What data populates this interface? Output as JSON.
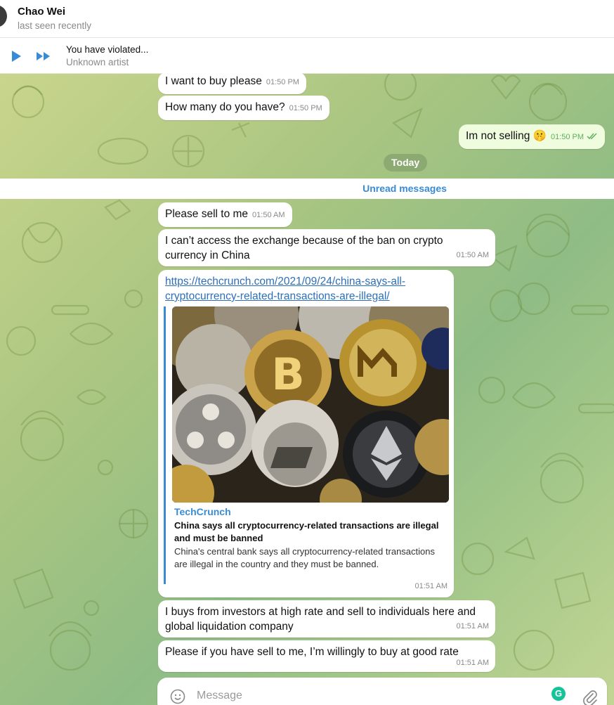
{
  "header": {
    "name": "Chao Wei",
    "status": "last seen recently"
  },
  "player": {
    "title": "You have violated...",
    "artist": "Unknown artist",
    "play_icon": "play-icon",
    "next_icon": "fast-forward-icon"
  },
  "messages_before": [
    {
      "text": "I want to buy please",
      "time": "01:50 PM",
      "direction": "in"
    },
    {
      "text": "How many do you have?",
      "time": "01:50 PM",
      "direction": "in"
    },
    {
      "text": "Im not selling",
      "emoji": "🤫",
      "time": "01:50 PM",
      "direction": "out",
      "read": true
    }
  ],
  "date_divider": "Today",
  "unread_label": "Unread messages",
  "messages_after": [
    {
      "text": "Please sell to me",
      "time": "01:50 AM"
    },
    {
      "text": "I can’t access the exchange because of the ban on crypto currency in China",
      "time": "01:50 AM"
    },
    {
      "link_line1": "https://techcrunch.com/2021/09/24/china-says-all-",
      "link_line2": "cryptocurrency-related-transactions-are-illegal/",
      "preview": {
        "site": "TechCrunch",
        "title": "China says all cryptocurrency-related transactions are illegal and must be banned",
        "description": "China's central bank says all cryptocurrency-related transactions are illegal in the country and they must be banned.",
        "image_alt": "crypto-coins-image"
      },
      "time": "01:51 AM"
    },
    {
      "text": "I buys from investors at high rate and sell to individuals here and global liquidation company",
      "time": "01:51 AM"
    },
    {
      "text": "Please if you have sell to me, I’m willingly to buy at good rate",
      "time": "01:51 AM"
    }
  ],
  "composer": {
    "placeholder": "Message",
    "emoji_icon": "smiley-icon",
    "attach_icon": "paperclip-icon",
    "grammarly_label": "G"
  },
  "colors": {
    "accent": "#3a8bd6",
    "outgoing_bubble": "#effdde",
    "read_check": "#5faf5f"
  }
}
